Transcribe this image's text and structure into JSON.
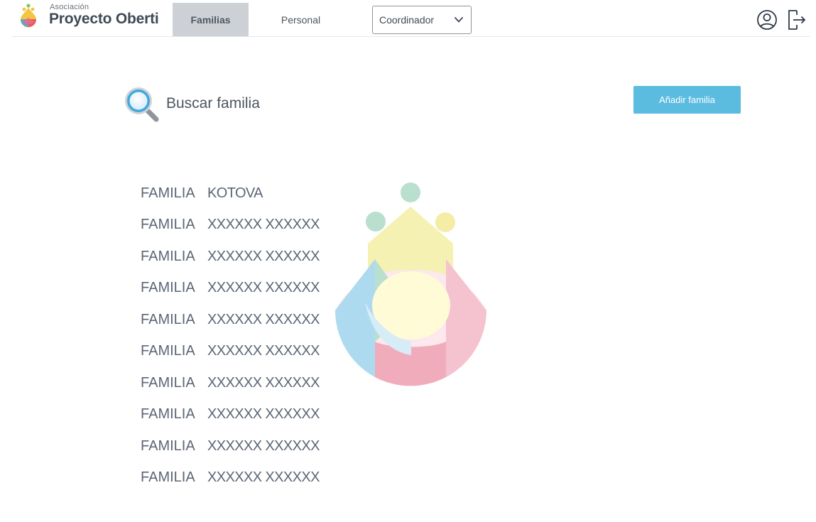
{
  "header": {
    "logo": {
      "small_text": "Asociación",
      "big_text": "Proyecto Oberti",
      "colors": [
        "#f4c542",
        "#e64c6b",
        "#4aa3d8",
        "#8bc34a"
      ]
    },
    "tabs": [
      {
        "label": "Familias",
        "active": true
      },
      {
        "label": "Personal",
        "active": false
      }
    ],
    "role_select": {
      "value": "Coordinador",
      "icon": "chevron-down-icon"
    },
    "user_icon": "user-circle-icon",
    "logout_icon": "logout-icon"
  },
  "search": {
    "placeholder": "Buscar familia",
    "icon": "search-icon"
  },
  "add_button": {
    "label": "Añadir familia",
    "color": "#5bbce0"
  },
  "families": [
    {
      "prefix": "FAMILIA",
      "surname": "KOTOVA"
    },
    {
      "prefix": "FAMILIA",
      "surname": "XXXXXX XXXXXX"
    },
    {
      "prefix": "FAMILIA",
      "surname": "XXXXXX XXXXXX"
    },
    {
      "prefix": "FAMILIA",
      "surname": "XXXXXX XXXXXX"
    },
    {
      "prefix": "FAMILIA",
      "surname": "XXXXXX XXXXXX"
    },
    {
      "prefix": "FAMILIA",
      "surname": "XXXXXX XXXXXX"
    },
    {
      "prefix": "FAMILIA",
      "surname": "XXXXXX XXXXXX"
    },
    {
      "prefix": "FAMILIA",
      "surname": "XXXXXX XXXXXX"
    },
    {
      "prefix": "FAMILIA",
      "surname": "XXXXXX XXXXXX"
    },
    {
      "prefix": "FAMILIA",
      "surname": "XXXXXX XXXXXX"
    }
  ]
}
